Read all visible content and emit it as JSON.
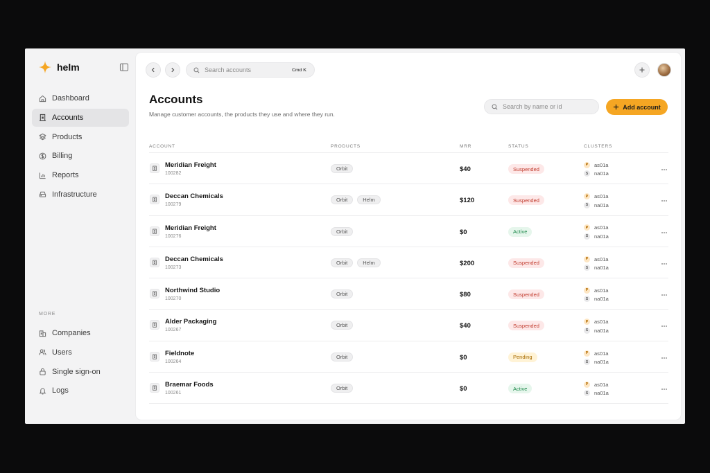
{
  "brand": {
    "name": "helm",
    "accent": "#f5a623"
  },
  "sidebar": {
    "items": [
      {
        "label": "Dashboard",
        "icon": "home-icon",
        "active": false
      },
      {
        "label": "Accounts",
        "icon": "building-icon",
        "active": true
      },
      {
        "label": "Products",
        "icon": "layers-icon",
        "active": false
      },
      {
        "label": "Billing",
        "icon": "dollar-circle-icon",
        "active": false
      },
      {
        "label": "Reports",
        "icon": "bar-chart-icon",
        "active": false
      },
      {
        "label": "Infrastructure",
        "icon": "server-icon",
        "active": false
      }
    ],
    "more_label": "MORE",
    "more_items": [
      {
        "label": "Companies",
        "icon": "companies-icon"
      },
      {
        "label": "Users",
        "icon": "users-icon"
      },
      {
        "label": "Single sign-on",
        "icon": "lock-icon"
      },
      {
        "label": "Logs",
        "icon": "bell-icon"
      }
    ]
  },
  "topbar": {
    "search_placeholder": "Search accounts",
    "shortcut": "Cmd K"
  },
  "page": {
    "title": "Accounts",
    "subtitle": "Manage customer accounts, the products they use and where they run.",
    "filter_placeholder": "Search by name or id",
    "add_button": "Add account"
  },
  "table": {
    "headers": {
      "account": "ACCOUNT",
      "products": "PRODUCTS",
      "mrr": "MRR",
      "status": "STATUS",
      "clusters": "CLUSTERS"
    },
    "rows": [
      {
        "name": "Meridian Freight",
        "id": "100282",
        "products": [
          "Orbit"
        ],
        "mrr": "$40",
        "status": "Suspended",
        "status_type": "suspended",
        "clusters": [
          {
            "badge": "P",
            "name": "as01a"
          },
          {
            "badge": "S",
            "name": "na01a"
          }
        ]
      },
      {
        "name": "Deccan Chemicals",
        "id": "100279",
        "products": [
          "Orbit",
          "Helm"
        ],
        "mrr": "$120",
        "status": "Suspended",
        "status_type": "suspended",
        "clusters": [
          {
            "badge": "P",
            "name": "as01a"
          },
          {
            "badge": "S",
            "name": "na01a"
          }
        ]
      },
      {
        "name": "Meridian Freight",
        "id": "100276",
        "products": [
          "Orbit"
        ],
        "mrr": "$0",
        "status": "Active",
        "status_type": "active",
        "clusters": [
          {
            "badge": "P",
            "name": "as01a"
          },
          {
            "badge": "S",
            "name": "na01a"
          }
        ]
      },
      {
        "name": "Deccan Chemicals",
        "id": "100273",
        "products": [
          "Orbit",
          "Helm"
        ],
        "mrr": "$200",
        "status": "Suspended",
        "status_type": "suspended",
        "clusters": [
          {
            "badge": "P",
            "name": "as01a"
          },
          {
            "badge": "S",
            "name": "na01a"
          }
        ]
      },
      {
        "name": "Northwind Studio",
        "id": "100270",
        "products": [
          "Orbit"
        ],
        "mrr": "$80",
        "status": "Suspended",
        "status_type": "suspended",
        "clusters": [
          {
            "badge": "P",
            "name": "as01a"
          },
          {
            "badge": "S",
            "name": "na01a"
          }
        ]
      },
      {
        "name": "Alder Packaging",
        "id": "100267",
        "products": [
          "Orbit"
        ],
        "mrr": "$40",
        "status": "Suspended",
        "status_type": "suspended",
        "clusters": [
          {
            "badge": "P",
            "name": "as01a"
          },
          {
            "badge": "S",
            "name": "na01a"
          }
        ]
      },
      {
        "name": "Fieldnote",
        "id": "100264",
        "products": [
          "Orbit"
        ],
        "mrr": "$0",
        "status": "Pending",
        "status_type": "pending",
        "clusters": [
          {
            "badge": "P",
            "name": "as01a"
          },
          {
            "badge": "S",
            "name": "na01a"
          }
        ]
      },
      {
        "name": "Braemar Foods",
        "id": "100261",
        "products": [
          "Orbit"
        ],
        "mrr": "$0",
        "status": "Active",
        "status_type": "active",
        "clusters": [
          {
            "badge": "P",
            "name": "as01a"
          },
          {
            "badge": "S",
            "name": "na01a"
          }
        ]
      }
    ]
  }
}
